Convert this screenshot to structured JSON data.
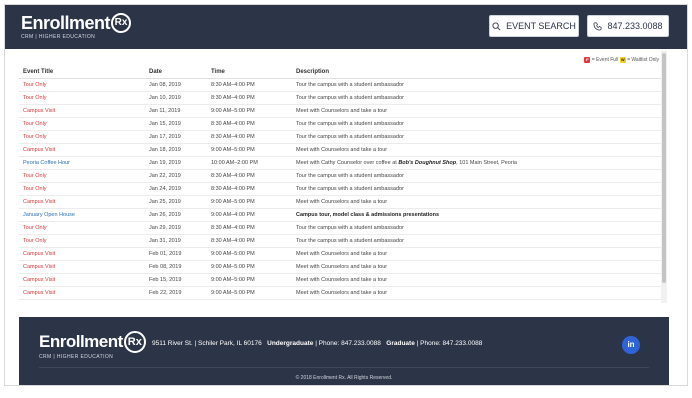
{
  "brand": {
    "name": "Enrollment",
    "badge": "Rx",
    "tagline": "CRM | HIGHER EDUCATION"
  },
  "header": {
    "search_label": "EVENT SEARCH",
    "phone_label": "847.233.0088"
  },
  "legend": {
    "full_mark": "F",
    "full_text": "= Event Full",
    "waitlist_mark": "W",
    "waitlist_text": "= Waitlist Only"
  },
  "table": {
    "columns": [
      "Event Title",
      "Date",
      "Time",
      "Description"
    ],
    "rows": [
      {
        "title": "Tour Only",
        "date": "Jan 08, 2019",
        "time": "8:30 AM–4:00 PM",
        "desc": "Tour the campus with a student ambassador",
        "color": "red"
      },
      {
        "title": "Tour Only",
        "date": "Jan 10, 2019",
        "time": "8:30 AM–4:00 PM",
        "desc": "Tour the campus with a student ambassador",
        "color": "red"
      },
      {
        "title": "Campus Visit",
        "date": "Jan 11, 2019",
        "time": "9:00 AM–5:00 PM",
        "desc": "Meet with Counselors and take a tour",
        "color": "red"
      },
      {
        "title": "Tour Only",
        "date": "Jan 15, 2019",
        "time": "8:30 AM–4:00 PM",
        "desc": "Tour the campus with a student ambassador",
        "color": "red"
      },
      {
        "title": "Tour Only",
        "date": "Jan 17, 2019",
        "time": "8:30 AM–4:00 PM",
        "desc": "Tour the campus with a student ambassador",
        "color": "red"
      },
      {
        "title": "Campus Visit",
        "date": "Jan 18, 2019",
        "time": "9:00 AM–5:00 PM",
        "desc": "Meet with Counselors and take a tour",
        "color": "red"
      },
      {
        "title": "Peoria Coffee Hour",
        "date": "Jan 19, 2019",
        "time": "10:00 AM–2:00 PM",
        "desc": "Meet with Cathy Counselor over coffee at ",
        "desc_bold": "Bob's Doughnut Shop",
        "desc_after": ", 101 Main Street, Peoria",
        "color": "blue"
      },
      {
        "title": "Tour Only",
        "date": "Jan 22, 2019",
        "time": "8:30 AM–4:00 PM",
        "desc": "Tour the campus with a student ambassador",
        "color": "red"
      },
      {
        "title": "Tour Only",
        "date": "Jan 24, 2019",
        "time": "8:30 AM–4:00 PM",
        "desc": "Tour the campus with a student ambassador",
        "color": "red"
      },
      {
        "title": "Campus Visit",
        "date": "Jan 25, 2019",
        "time": "9:00 AM–5:00 PM",
        "desc": "Meet with Counselors and take a tour",
        "color": "red"
      },
      {
        "title": "January Open House",
        "date": "Jan 26, 2019",
        "time": "9:00 AM–4:00 PM",
        "desc_bold": "Campus tour, model class & admissions presentations",
        "color": "blue"
      },
      {
        "title": "Tour Only",
        "date": "Jan 29, 2019",
        "time": "8:30 AM–4:00 PM",
        "desc": "Tour the campus with a student ambassador",
        "color": "red"
      },
      {
        "title": "Tour Only",
        "date": "Jan 31, 2019",
        "time": "8:30 AM–4:00 PM",
        "desc": "Tour the campus with a student ambassador",
        "color": "red"
      },
      {
        "title": "Campus Visit",
        "date": "Feb 01, 2019",
        "time": "9:00 AM–5:00 PM",
        "desc": "Meet with Counselors and take a tour",
        "color": "red"
      },
      {
        "title": "Campus Visit",
        "date": "Feb 08, 2019",
        "time": "9:00 AM–5:00 PM",
        "desc": "Meet with Counselors and take a tour",
        "color": "red"
      },
      {
        "title": "Campus Visit",
        "date": "Feb 15, 2019",
        "time": "9:00 AM–5:00 PM",
        "desc": "Meet with Counselors and take a tour",
        "color": "red"
      },
      {
        "title": "Campus Visit",
        "date": "Feb 22, 2019",
        "time": "9:00 AM–5:00 PM",
        "desc": "Meet with Counselors and take a tour",
        "color": "red"
      }
    ]
  },
  "footer": {
    "address": "9511 River St. | Schiler Park, IL 60176",
    "undergrad_label": "Undergraduate",
    "undergrad_phone": "| Phone: 847.233.0088",
    "grad_label": "Graduate",
    "grad_phone": "| Phone: 847.233.0088",
    "social": "in",
    "copyright": "© 2018 Enrollment Rx. All Rights Reserved."
  },
  "colors": {
    "navy": "#2c3447",
    "red": "#d8383a",
    "blue": "#2e6fb7",
    "linkedin": "#2e64d6"
  }
}
